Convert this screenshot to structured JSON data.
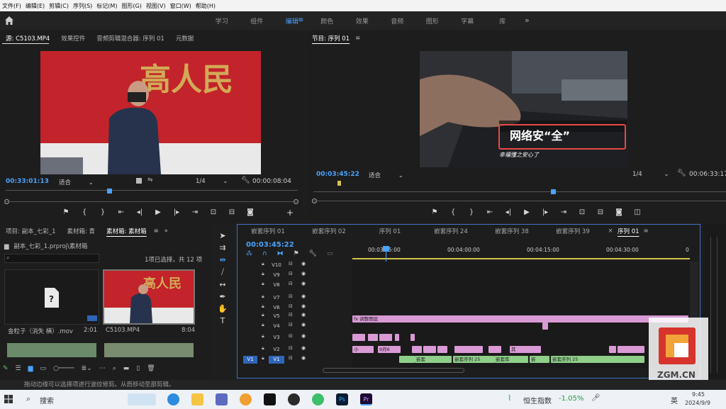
{
  "menu": [
    "文件(F)",
    "编辑(E)",
    "剪辑(C)",
    "序列(S)",
    "标记(M)",
    "图形(G)",
    "视图(V)",
    "窗口(W)",
    "帮助(H)"
  ],
  "workspaces": {
    "tabs": [
      "学习",
      "组件",
      "编辑",
      "颜色",
      "效果",
      "音频",
      "图形",
      "字幕",
      "库"
    ],
    "active_index": 2
  },
  "source": {
    "tabs": [
      "源: C5103.MP4",
      "效果控件",
      "音频剪辑混合器: 序列 01",
      "元数据"
    ],
    "timecode": "00:33:01:13",
    "fit": "适合",
    "quality": "1/4",
    "duration": "00:00:08:04",
    "video_text": "高人民"
  },
  "program": {
    "tab": "节目: 序列 01",
    "timecode": "00:03:45:22",
    "fit": "适合",
    "quality": "1/4",
    "duration": "00:06:33:17",
    "title_overlay": "网络安“全”",
    "subtitle_overlay": "幸福懂之安心了"
  },
  "project": {
    "tabs": [
      "项目: 副本_七彩_1",
      "素材箱: 青",
      "素材箱: 素材箱"
    ],
    "path": "副本_七彩_1.prproj\\素材箱",
    "selection_info": "1项已选择，共 12 项",
    "items": [
      {
        "name": "金粒子（消失 横）.mov",
        "duration": "2:01"
      },
      {
        "name": "C5103.MP4",
        "duration": "8:04"
      }
    ]
  },
  "timeline": {
    "tabs": [
      "嵌套序列 01",
      "嵌套序列 02",
      "序列 01",
      "嵌套序列 24",
      "嵌套序列 38",
      "嵌套序列 39",
      "序列 01"
    ],
    "timecode": "00:03:45:22",
    "ruler": [
      "00:03:45:00",
      "00:04:00:00",
      "00:04:15:00",
      "00:04:30:00",
      "0"
    ],
    "tracks": [
      "V10",
      "V9",
      "V8",
      "V7",
      "V6",
      "V5",
      "V4",
      "V3",
      "V2",
      "V1"
    ],
    "clip_labels": {
      "adjust": "调整图层",
      "v2_a": "小",
      "v2_b": "9月6",
      "v2_c": "其",
      "v1_a": "嵌套",
      "v1_b": "嵌套序列 25",
      "v1_c": "嵌套库",
      "v1_d": "嵌",
      "v1_e": "嵌套序列 25"
    },
    "src_patch": "V1"
  },
  "status_text": "拖动边缘可以选择项进行波纹修剪。从而移动至部剪辑。",
  "taskbar": {
    "search": "搜索",
    "stock_name": "恒生指数",
    "stock_change": "-1.05%",
    "ime": "英",
    "time": "9:45",
    "date": "2024/9/9"
  },
  "watermark": "ZGM.CN",
  "colors": {
    "accent": "#4aa3ff",
    "clip_pink": "#d99ad6",
    "clip_green": "#8fcf8a",
    "title_red": "#e84848"
  }
}
